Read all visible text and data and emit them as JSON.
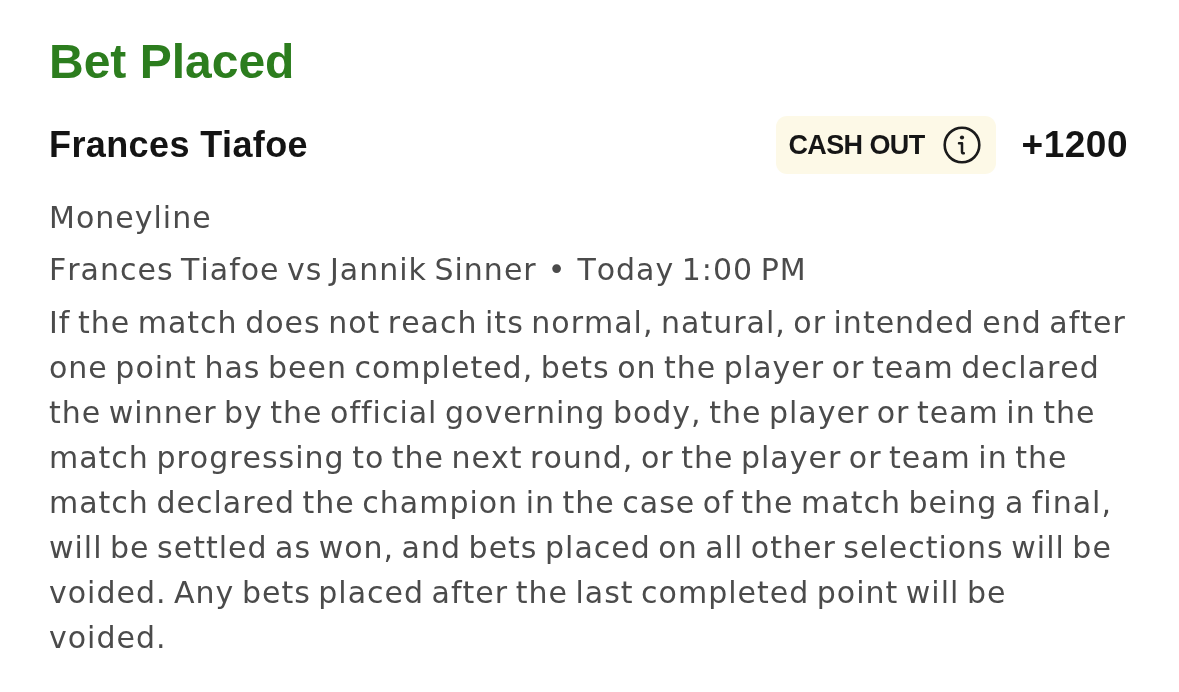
{
  "header": {
    "title": "Bet Placed"
  },
  "selection": {
    "name": "Frances Tiafoe",
    "cash_out": {
      "label": "CASH OUT"
    },
    "odds": "+1200"
  },
  "market": "Moneyline",
  "event": {
    "matchup": "Frances Tiafoe vs Jannik Sinner",
    "separator": "•",
    "start_time": "Today 1:00 PM"
  },
  "rules": "If the match does not reach its normal, natural, or intended end after one point has been completed, bets on the player or team declared the winner by the official governing body, the player or team in the match progressing to the next round, or the player or team in the match declared the champion in the case of the match being a final, will be settled as won, and bets placed on all other selections will be voided. Any bets placed after the last completed point will be voided."
}
